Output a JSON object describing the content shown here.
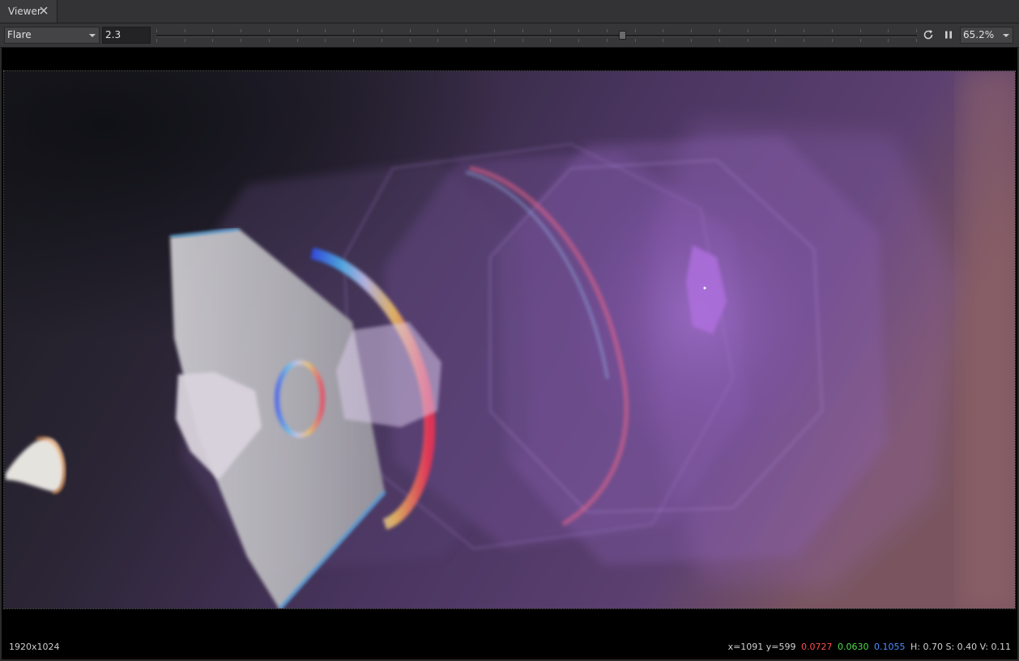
{
  "tab": {
    "title": "Viewer",
    "close_icon": "close-icon"
  },
  "toolbar": {
    "layer_select": "Flare",
    "value_field": "2.3",
    "timeline_position": 0.612,
    "refresh_icon": "refresh-icon",
    "pause_icon": "pause-icon",
    "zoom": "65.2%"
  },
  "viewer": {
    "image_content": "lens-flare-render",
    "resolution": "1920x1024",
    "pixel_info": {
      "coords": "x=1091 y=599",
      "r": "0.0727",
      "g": "0.0630",
      "b": "0.1055",
      "hsv": "H: 0.70 S: 0.40 V: 0.11"
    }
  },
  "colors": {
    "r": "#ff4d4d",
    "g": "#4ddc4d",
    "b": "#4d8dff",
    "accent_purple": "#9a6ad0"
  }
}
